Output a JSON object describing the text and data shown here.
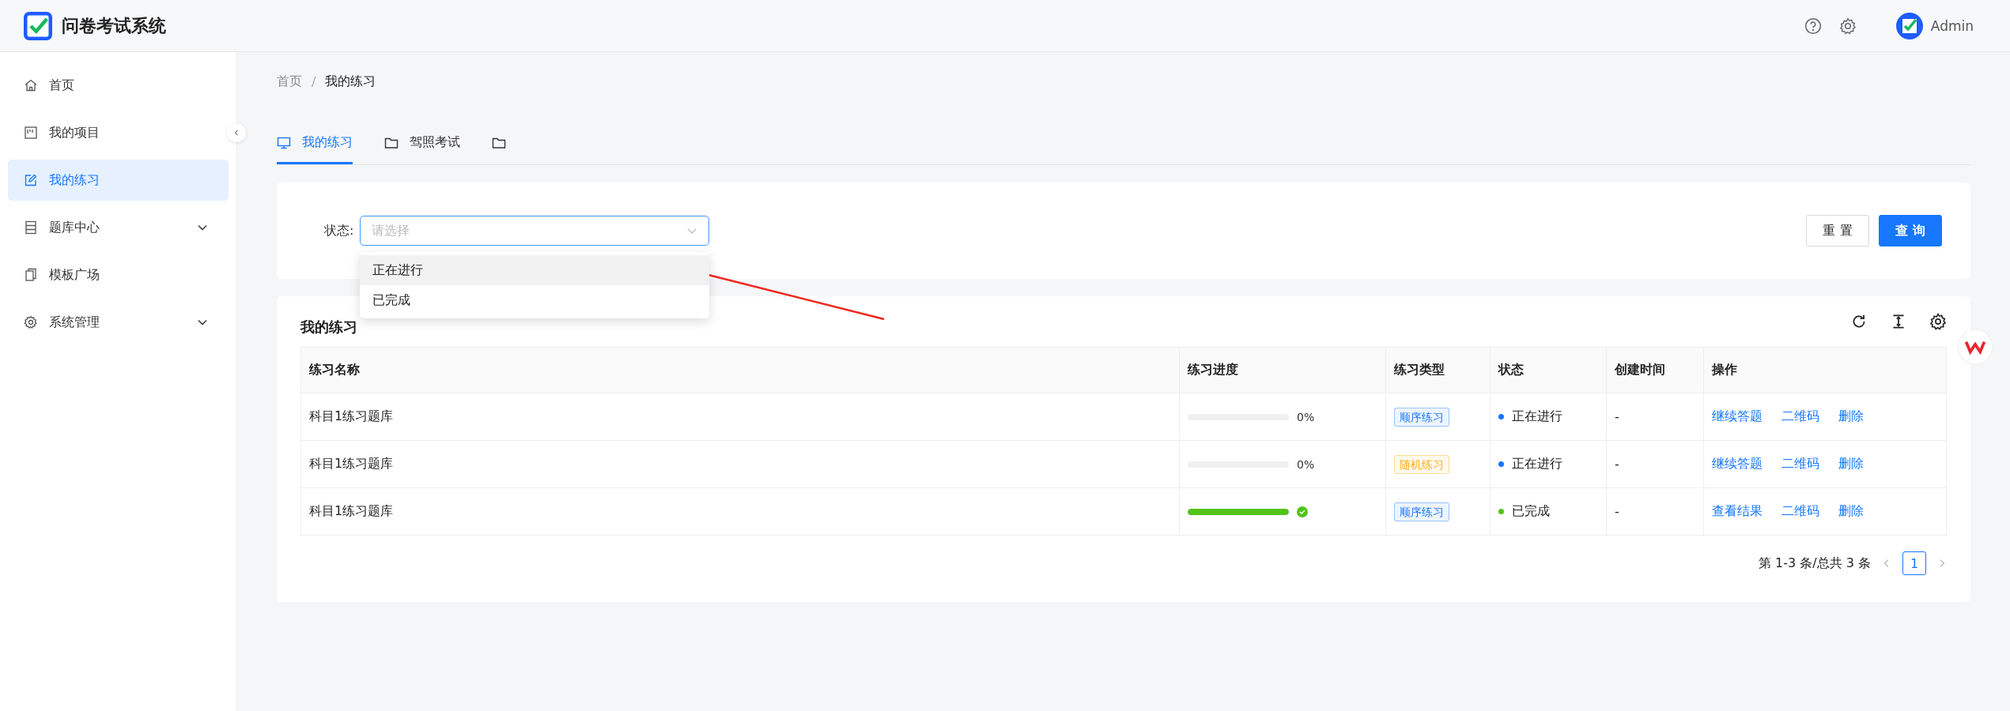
{
  "header": {
    "title": "问卷考试系统",
    "user": "Admin"
  },
  "sidebar": {
    "items": [
      {
        "label": "首页",
        "selected": false
      },
      {
        "label": "我的项目",
        "selected": false
      },
      {
        "label": "我的练习",
        "selected": true
      },
      {
        "label": "题库中心",
        "selected": false,
        "expanded": false
      },
      {
        "label": "模板广场",
        "selected": false
      },
      {
        "label": "系统管理",
        "selected": false,
        "expanded": false
      }
    ]
  },
  "breadcrumb": {
    "separator": "/",
    "items": [
      "首页",
      "我的练习"
    ]
  },
  "tabs": [
    {
      "label": "我的练习",
      "selected": true
    },
    {
      "label": "驾照考试",
      "selected": false
    },
    {
      "selected": false
    }
  ],
  "filter": {
    "label": "状态:",
    "placeholder": "请选择",
    "options": [
      {
        "label": "正在进行",
        "highlighted": true
      },
      {
        "label": "已完成",
        "highlighted": false
      }
    ],
    "buttons": [
      {
        "label": "重置",
        "primary": false
      },
      {
        "label": "查询",
        "primary": true
      }
    ]
  },
  "table": {
    "title": "我的练习",
    "columns": [
      "练习名称",
      "练习进度",
      "练习类型",
      "状态",
      "创建时间",
      "操作"
    ],
    "rows": [
      {
        "name": "科目1练习题库",
        "progress": {
          "level": 0,
          "done": false,
          "reading": "0%"
        },
        "type": {
          "label": "顺序练习",
          "color": "#1677ff"
        },
        "status": {
          "label": "正在进行",
          "color": "#1677ff"
        },
        "created": "-",
        "actions": [
          "继续答题",
          "二维码",
          "删除"
        ]
      },
      {
        "name": "科目1练习题库",
        "progress": {
          "level": 0,
          "done": false,
          "reading": "0%"
        },
        "type": {
          "label": "随机练习",
          "color": "#faad14"
        },
        "status": {
          "label": "正在进行",
          "color": "#1677ff"
        },
        "created": "-",
        "actions": [
          "继续答题",
          "二维码",
          "删除"
        ]
      },
      {
        "name": "科目1练习题库",
        "progress": {
          "level": 1,
          "done": true
        },
        "type": {
          "label": "顺序练习",
          "color": "#1677ff"
        },
        "status": {
          "label": "已完成",
          "color": "#52c41a"
        },
        "created": "-",
        "actions": [
          "查看结果",
          "二维码",
          "删除"
        ]
      }
    ],
    "pagination": {
      "summary": "第 1-3 条/总共 3 条",
      "pages": [
        {
          "label": "1",
          "selected": true
        }
      ]
    }
  }
}
